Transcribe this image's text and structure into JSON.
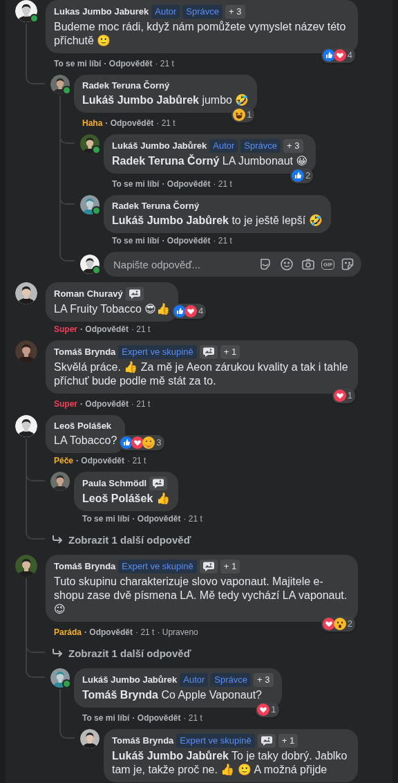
{
  "comments": [
    {
      "kind": "comment",
      "author": "Lukas Jumbo Jaburek",
      "online": true,
      "badges": [
        {
          "kind": "role",
          "text": "Autor"
        },
        {
          "kind": "role",
          "text": "Správce"
        },
        {
          "kind": "count",
          "text": "+ 3"
        }
      ],
      "body": "Budeme moc rádi, když nám pomůžete vymyslet název této příchutě 🙂",
      "reactions": [
        {
          "kind": "like"
        },
        {
          "kind": "love"
        }
      ],
      "reaction_count": "4",
      "my_reaction": {
        "kind": "none",
        "label": "To se mi líbí"
      },
      "reply": "· Odpovědět",
      "time": "· 21 t",
      "children": [
        {
          "kind": "comment",
          "author": "Radek Teruna Čorný",
          "online": true,
          "body": "**Lukáš Jumbo Jabůrek** jumbo 🤣",
          "reactions": [
            {
              "kind": "haha"
            }
          ],
          "reaction_count": "1",
          "my_reaction": {
            "kind": "haha",
            "label": "Haha"
          },
          "reply": "· Odpovědět",
          "time": "· 21 t",
          "children": [
            {
              "kind": "comment",
              "author": "Lukáš Jumbo Jabůrek",
              "online": true,
              "badges": [
                {
                  "kind": "role",
                  "text": "Autor"
                },
                {
                  "kind": "role",
                  "text": "Správce"
                },
                {
                  "kind": "count",
                  "text": "+ 3"
                }
              ],
              "body": "**Radek Teruna Čorný** LA Jumbonaut 😀",
              "reactions": [
                {
                  "kind": "like"
                }
              ],
              "reaction_count": "2",
              "my_reaction": {
                "kind": "none",
                "label": "To se mi líbí"
              },
              "reply": "· Odpovědět",
              "time": "· 21 t"
            },
            {
              "kind": "comment",
              "author": "Radek Teruna Čorný",
              "online": true,
              "body": "**Lukáš Jumbo Jabůrek** to je ještě lepší 🤣",
              "my_reaction": {
                "kind": "none",
                "label": "To se mi líbí"
              },
              "reply": "· Odpovědět",
              "time": "· 21 t"
            },
            {
              "kind": "reply_box",
              "online": true,
              "placeholder": "Napište odpověď...",
              "gif": "GIF"
            }
          ]
        }
      ]
    },
    {
      "kind": "comment",
      "author": "Roman Churavý",
      "badges": [
        {
          "kind": "icon"
        }
      ],
      "body": "LA Fruity Tobacco 😎👍",
      "reactions": [
        {
          "kind": "like"
        },
        {
          "kind": "love"
        }
      ],
      "reaction_count": "4",
      "my_reaction": {
        "kind": "love",
        "label": "Super"
      },
      "reply": "· Odpovědět",
      "time": "· 21 t"
    },
    {
      "kind": "comment",
      "author": "Tomáš Brynda",
      "badges": [
        {
          "kind": "role",
          "text": "Expert ve skupině"
        },
        {
          "kind": "icon"
        },
        {
          "kind": "count",
          "text": "+ 1"
        }
      ],
      "body": "Skvělá práce. 👍 Za mě je Aeon zárukou kvality a tak i tahle příchuť bude podle mě stát za to.",
      "reactions": [
        {
          "kind": "love"
        }
      ],
      "reaction_count": "1",
      "my_reaction": {
        "kind": "love",
        "label": "Super"
      },
      "reply": "· Odpovědět",
      "time": "· 21 t"
    },
    {
      "kind": "comment",
      "author": "Leoš Polášek",
      "body": "LA Tobacco?",
      "reactions": [
        {
          "kind": "like"
        },
        {
          "kind": "love"
        },
        {
          "kind": "care"
        }
      ],
      "reaction_count": "3",
      "my_reaction": {
        "kind": "care",
        "label": "Péče"
      },
      "reply": "· Odpovědět",
      "time": "· 21 t",
      "children": [
        {
          "kind": "comment",
          "author": "Paula Schmödl",
          "badges": [
            {
              "kind": "icon"
            }
          ],
          "body": "**Leoš Polášek** 👍",
          "my_reaction": {
            "kind": "none",
            "label": "To se mi líbí"
          },
          "reply": "· Odpovědět",
          "time": "· 21 t"
        },
        {
          "kind": "more",
          "text": "Zobrazit 1 další odpověď"
        }
      ]
    },
    {
      "kind": "comment",
      "author": "Tomáš Brynda",
      "badges": [
        {
          "kind": "role",
          "text": "Expert ve skupině"
        },
        {
          "kind": "icon"
        },
        {
          "kind": "count",
          "text": "+ 1"
        }
      ],
      "body": "Tuto skupinu charakterizuje slovo vaponaut. Majitele e-shopu zase dvě písmena LA. Mě tedy vychází LA vaponaut. 😉",
      "reactions": [
        {
          "kind": "love"
        },
        {
          "kind": "wow"
        }
      ],
      "reaction_count": "2",
      "my_reaction": {
        "kind": "wow",
        "label": "Paráda"
      },
      "reply": "· Odpovědět",
      "time": "· 21 t",
      "edited": "· Upraveno",
      "children": [
        {
          "kind": "more",
          "text": "Zobrazit 1 další odpověď"
        },
        {
          "kind": "comment",
          "author": "Lukáš Jumbo Jabůrek",
          "online": true,
          "badges": [
            {
              "kind": "role",
              "text": "Autor"
            },
            {
              "kind": "role",
              "text": "Správce"
            },
            {
              "kind": "count",
              "text": "+ 3"
            }
          ],
          "body": "**Tomáš Brynda** Co Apple Vaponaut?",
          "reactions": [
            {
              "kind": "love"
            }
          ],
          "reaction_count": "1",
          "my_reaction": {
            "kind": "none",
            "label": "To se mi líbí"
          },
          "reply": "· Odpovědět",
          "time": "· 21 t",
          "children": [
            {
              "kind": "comment",
              "author": "Tomáš Brynda",
              "badges": [
                {
                  "kind": "role",
                  "text": "Expert ve skupině"
                },
                {
                  "kind": "icon"
                },
                {
                  "kind": "count",
                  "text": "+ 1"
                }
              ],
              "body": "**Lukáš Jumbo Jabůrek** To je taky dobrý. Jablko tam je, takže proč ne. 👍 🙂 A možná přijde"
            }
          ]
        }
      ]
    }
  ]
}
